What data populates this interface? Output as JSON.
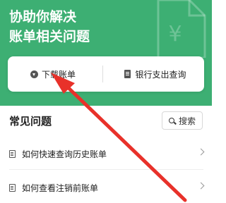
{
  "hero": {
    "title_line1": "协助你解决",
    "title_line2": "账单相关问题",
    "doc_symbol": "¥"
  },
  "quick_actions": {
    "download": {
      "label": "下载账单",
      "icon": "download-icon"
    },
    "bank": {
      "label": "银行支出查询",
      "icon": "document-icon"
    }
  },
  "faq": {
    "title": "常见问题",
    "search_label": "搜索",
    "items": [
      {
        "label": "如何快速查询历史账单"
      },
      {
        "label": "如何查看注销前账单"
      }
    ]
  },
  "colors": {
    "brand_green": "#3daf73",
    "arrow_red": "#e8312a"
  }
}
